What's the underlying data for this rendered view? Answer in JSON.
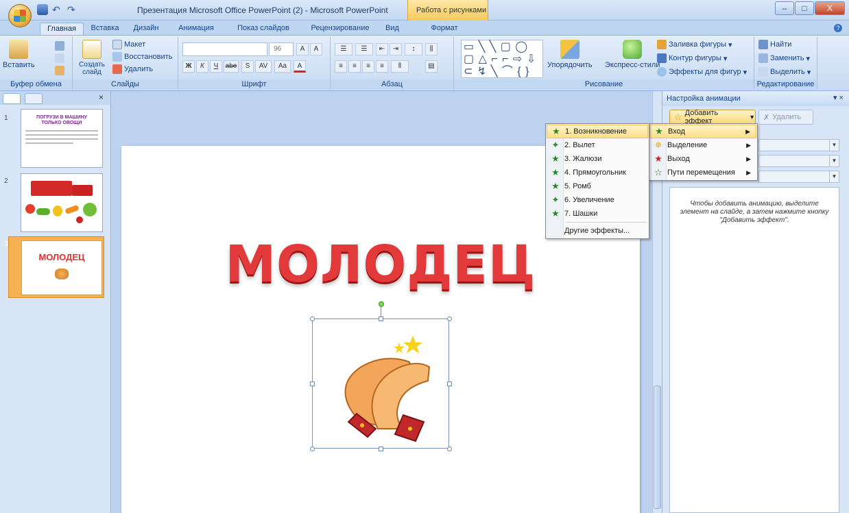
{
  "window": {
    "title": "Презентация Microsoft Office PowerPoint (2) - Microsoft PowerPoint",
    "context_tab_title": "Работа с рисунками",
    "minimize": "–",
    "maximize": "□",
    "close": "X"
  },
  "tabs": [
    "Главная",
    "Вставка",
    "Дизайн",
    "Анимация",
    "Показ слайдов",
    "Рецензирование",
    "Вид",
    "Формат"
  ],
  "ribbon": {
    "clipboard": {
      "label": "Буфер обмена",
      "paste": "Вставить"
    },
    "slides": {
      "label": "Слайды",
      "new_slide": "Создать слайд",
      "layout": "Макет",
      "reset": "Восстановить",
      "delete": "Удалить"
    },
    "font": {
      "label": "Шрифт",
      "size": "96",
      "bold": "Ж",
      "italic": "К",
      "underline": "Ч",
      "strike": "abe",
      "shadow": "S",
      "spacing": "AV",
      "case": "Aa",
      "color": "A"
    },
    "paragraph": {
      "label": "Абзац"
    },
    "drawing": {
      "label": "Рисование",
      "shapes": "▭ ╲ ╲ ▢ ◯ ▢ △ ⌐ ⌐ ⇨ ⇩ ⊂ ↯ ╲ ⌒ { } ☆",
      "arrange": "Упорядочить",
      "quick_styles": "Экспресс-стили",
      "fill": "Заливка фигуры",
      "outline": "Контур фигуры",
      "effects": "Эффекты для фигур"
    },
    "editing": {
      "label": "Редактирование",
      "find": "Найти",
      "replace": "Заменить",
      "select": "Выделить"
    }
  },
  "slides_panel": {
    "thumbs": [
      {
        "num": "1",
        "title": "ПОГРУЗИ В МАШИНУ ТОЛЬКО ОВОЩИ"
      },
      {
        "num": "2"
      },
      {
        "num": "3",
        "title": "МОЛОДЕЦ"
      }
    ]
  },
  "slide": {
    "title": "МОЛОДЕЦ"
  },
  "animation_pane": {
    "title": "Настройка анимации",
    "add_effect": "Добавить эффект",
    "remove": "Удалить",
    "hint": "Чтобы добавить анимацию, выделите элемент на слайде, а затем нажмите кнопку \"Добавить эффект\"."
  },
  "effect_menu": [
    {
      "label": "Вход",
      "icon": "green-star-icon"
    },
    {
      "label": "Выделение",
      "icon": "yellow-star-icon"
    },
    {
      "label": "Выход",
      "icon": "red-star-icon"
    },
    {
      "label": "Пути перемещения",
      "icon": "outline-star-icon"
    }
  ],
  "entrance_menu": [
    "1. Возникновение",
    "2. Вылет",
    "3. Жалюзи",
    "4. Прямоугольник",
    "5. Ромб",
    "6. Увеличение",
    "7. Шашки",
    "Другие эффекты..."
  ],
  "colors": {
    "accent": "#15428b",
    "title_red": "#e23a3a",
    "highlight": "#fddf8a"
  }
}
